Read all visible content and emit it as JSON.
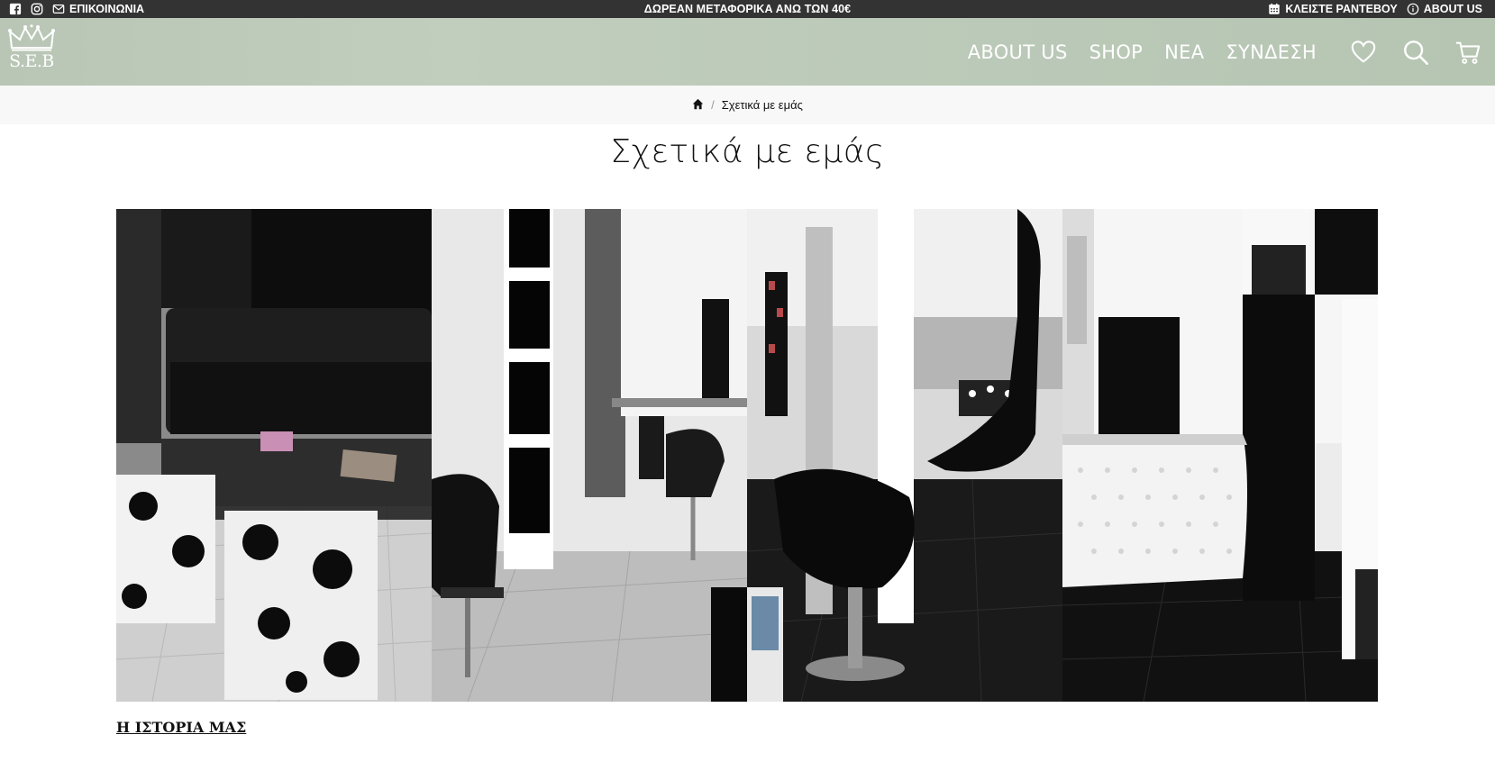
{
  "topbar": {
    "contact_label": "ΕΠΙΚΟΙΝΩΝΙΑ",
    "promo_text": "ΔΩΡΕΑΝ ΜΕΤΑΦΟΡΙΚΑ ΑΝΩ ΤΩΝ 40€",
    "appointment_label": "ΚΛΕΙΣΤΕ ΡΑΝΤΕΒΟΥ",
    "about_label": "ABOUT US"
  },
  "header": {
    "logo_text": "S.E.B",
    "nav": [
      {
        "label": "ABOUT US"
      },
      {
        "label": "SHOP"
      },
      {
        "label": "ΝΕΑ"
      },
      {
        "label": "ΣΥΝΔΕΣΗ"
      }
    ]
  },
  "breadcrumb": {
    "separator": "/",
    "current": "Σχετικά με εμάς"
  },
  "page": {
    "title": "Σχετικά με εμάς",
    "story_heading": "Η ΙΣΤΟΡΙΑ ΜΑΣ"
  },
  "hero": {
    "image_alt": "Black and white collage of the salon interior"
  },
  "colors": {
    "topbar_bg": "#333333",
    "header_bg": "#bcc8b8",
    "breadcrumb_bg": "#f8f8f8",
    "text": "#111111"
  },
  "icons": [
    "facebook-icon",
    "instagram-icon",
    "mail-icon",
    "calendar-icon",
    "info-icon",
    "crown-icon",
    "heart-icon",
    "search-icon",
    "cart-icon",
    "home-icon"
  ]
}
